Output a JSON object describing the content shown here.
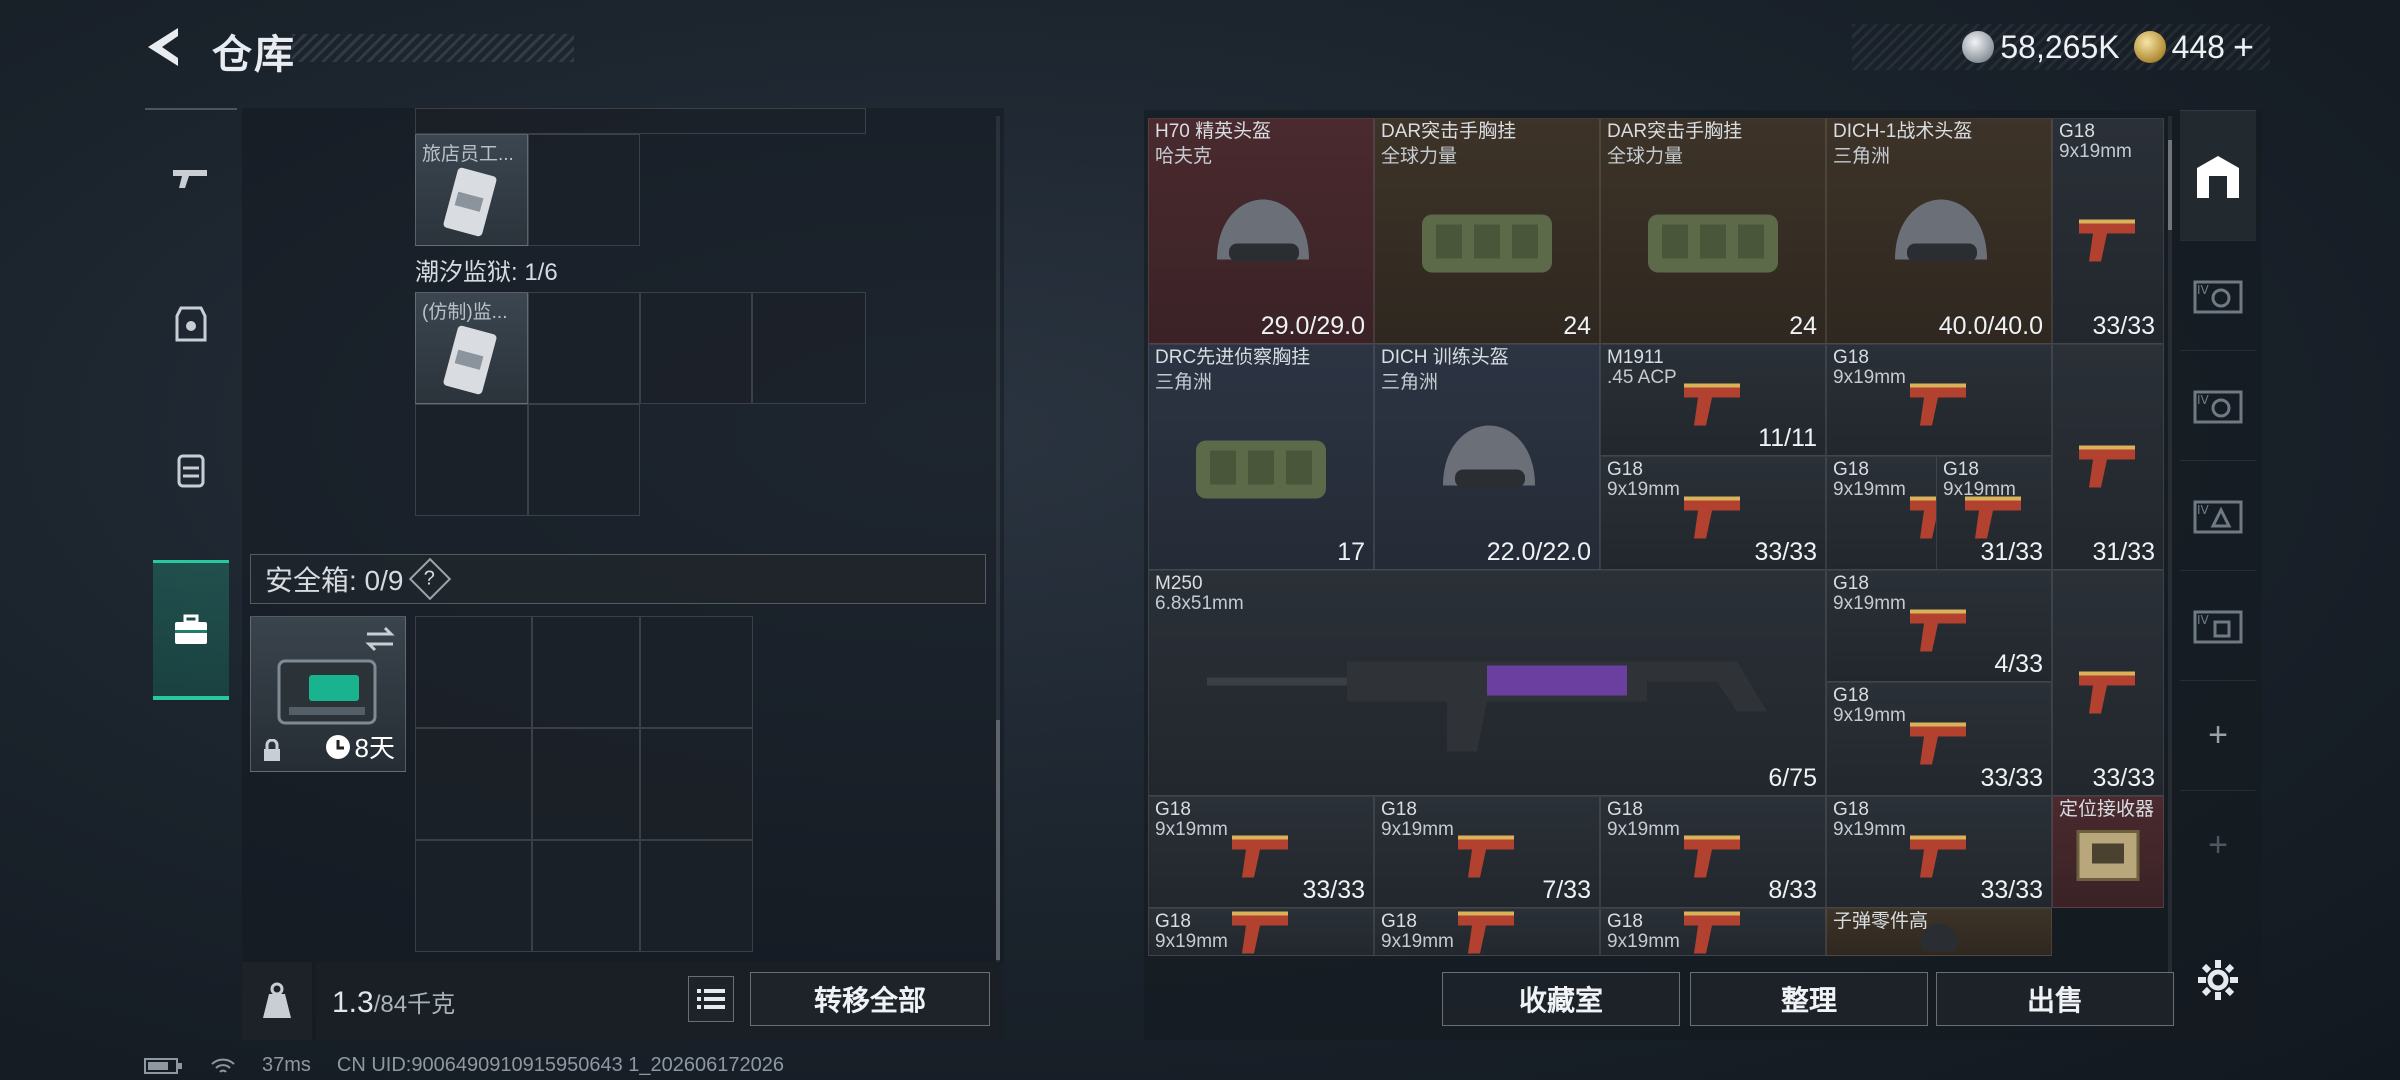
{
  "header": {
    "title": "仓库",
    "currency": [
      {
        "icon": "silver-coin-icon",
        "value": "58,265K"
      },
      {
        "icon": "gold-coin-icon",
        "value": "448"
      }
    ],
    "add_label": "+"
  },
  "left": {
    "top_item_name": "旅店员工...",
    "prison_label": "潮汐监狱: 1/6",
    "prison_item_name": "(仿制)监...",
    "safebox_label": "安全箱: 0/9",
    "help_label": "?",
    "safebox_timer": "8天",
    "weight_value": "1.3",
    "weight_max": "/84千克",
    "transfer_all": "转移全部"
  },
  "storage": {
    "items": [
      {
        "name": "H70 精英头盔",
        "sub": "哈夫克",
        "count": "29.0/29.0",
        "color": "red",
        "icon": "helmet-icon"
      },
      {
        "name": "DAR突击手胸挂",
        "sub": "全球力量",
        "count": "24",
        "color": "brown",
        "icon": "chest-rig-icon"
      },
      {
        "name": "DAR突击手胸挂",
        "sub": "全球力量",
        "count": "24",
        "color": "brown",
        "icon": "chest-rig-icon"
      },
      {
        "name": "DICH-1战术头盔",
        "sub": "三角洲",
        "count": "40.0/40.0",
        "color": "brown",
        "icon": "helmet-icon"
      },
      {
        "name": "G18",
        "sub": "9x19mm",
        "count": "33/33",
        "color": "dark",
        "icon": "pistol-icon"
      },
      {
        "name": "DRC先进侦察胸挂",
        "sub": "三角洲",
        "count": "17",
        "color": "blue",
        "icon": "chest-rig-icon"
      },
      {
        "name": "DICH 训练头盔",
        "sub": "三角洲",
        "count": "22.0/22.0",
        "color": "blue",
        "icon": "helmet-icon"
      },
      {
        "name": "M1911",
        "sub": ".45 ACP",
        "count": "11/11",
        "color": "dark",
        "icon": "pistol-icon"
      },
      {
        "name": "G18",
        "sub": "9x19mm",
        "count": "33/33",
        "color": "dark",
        "icon": "pistol-icon"
      },
      {
        "name": "G18",
        "sub": "9x19mm",
        "count": "",
        "color": "dark",
        "icon": "pistol-icon"
      },
      {
        "name": "G18",
        "sub": "9x19mm",
        "count": "33/33",
        "color": "dark",
        "icon": "pistol-icon"
      },
      {
        "name": "G18",
        "sub": "9x19mm",
        "count": "31/33",
        "color": "dark",
        "icon": "pistol-icon"
      },
      {
        "name": "",
        "sub": "",
        "count": "31/33",
        "color": "dark",
        "icon": "pistol-icon"
      },
      {
        "name": "M250",
        "sub": "6.8x51mm",
        "count": "6/75",
        "color": "dark",
        "icon": "machine-gun-icon"
      },
      {
        "name": "G18",
        "sub": "9x19mm",
        "count": "4/33",
        "color": "dark",
        "icon": "pistol-icon"
      },
      {
        "name": "G18",
        "sub": "9x19mm",
        "count": "",
        "color": "dark",
        "icon": "pistol-icon"
      },
      {
        "name": "G18",
        "sub": "9x19mm",
        "count": "33/33",
        "color": "dark",
        "icon": "pistol-icon"
      },
      {
        "name": "",
        "sub": "",
        "count": "33/33",
        "color": "dark",
        "icon": "pistol-icon"
      },
      {
        "name": "G18",
        "sub": "9x19mm",
        "count": "33/33",
        "color": "dark",
        "icon": "pistol-icon"
      },
      {
        "name": "G18",
        "sub": "9x19mm",
        "count": "7/33",
        "color": "dark",
        "icon": "pistol-icon"
      },
      {
        "name": "G18",
        "sub": "9x19mm",
        "count": "8/33",
        "color": "dark",
        "icon": "pistol-icon"
      },
      {
        "name": "G18",
        "sub": "9x19mm",
        "count": "33/33",
        "color": "dark",
        "icon": "pistol-icon"
      },
      {
        "name": "定位接收器",
        "sub": "",
        "count": "",
        "color": "red",
        "icon": "receiver-icon"
      },
      {
        "name": "G18",
        "sub": "9x19mm",
        "count": "",
        "color": "dark",
        "icon": "pistol-icon"
      },
      {
        "name": "G18",
        "sub": "9x19mm",
        "count": "",
        "color": "dark",
        "icon": "pistol-icon"
      },
      {
        "name": "G18",
        "sub": "9x19mm",
        "count": "",
        "color": "dark",
        "icon": "pistol-icon"
      },
      {
        "name": "子弹零件高",
        "sub": "",
        "count": "",
        "color": "brown",
        "icon": "parts-icon"
      }
    ],
    "buttons": {
      "collection": "收藏室",
      "organize": "整理",
      "sell": "出售"
    }
  },
  "status": {
    "ping": "37ms",
    "uid": "CN UID:9006490910915950643 1_202606172026"
  }
}
